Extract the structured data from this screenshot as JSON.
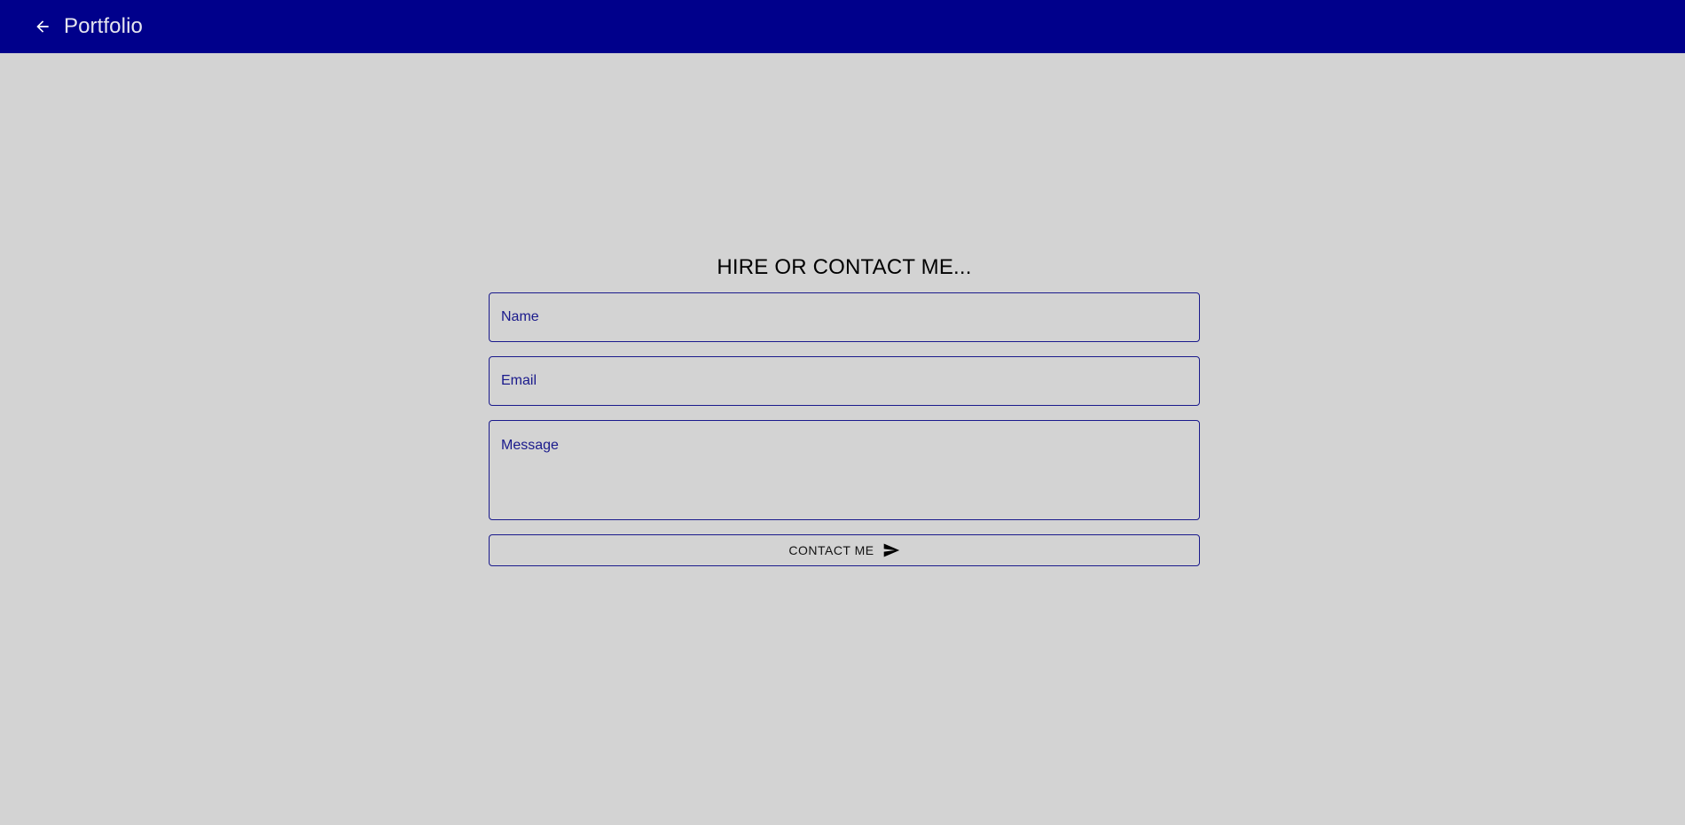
{
  "appbar": {
    "title": "Portfolio",
    "back_icon": "arrow-left-icon",
    "background": "#00008b"
  },
  "contact_form": {
    "heading": "HIRE OR CONTACT ME...",
    "name_placeholder": "Name",
    "email_placeholder": "Email",
    "message_placeholder": "Message",
    "submit_label": "CONTACT ME",
    "submit_icon": "send-icon",
    "accent": "#1a1a8c"
  },
  "page": {
    "background": "#d3d3d3"
  }
}
